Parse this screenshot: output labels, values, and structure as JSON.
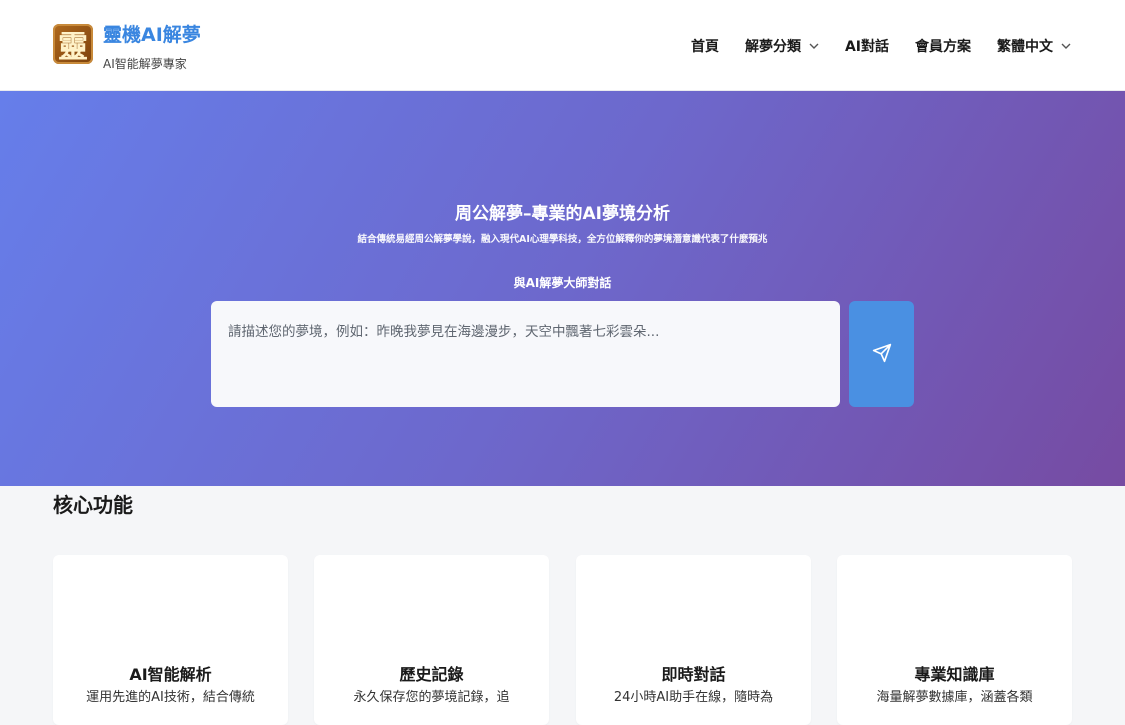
{
  "header": {
    "logo_glyph": "靈",
    "brand_name": "靈機AI解夢",
    "brand_tagline": "AI智能解夢專家",
    "nav": [
      {
        "label": "首頁",
        "dropdown": false
      },
      {
        "label": "解夢分類",
        "dropdown": true
      },
      {
        "label": "AI對話",
        "dropdown": false
      },
      {
        "label": "會員方案",
        "dropdown": false
      },
      {
        "label": "繁體中文",
        "dropdown": true
      }
    ]
  },
  "hero": {
    "title": "周公解夢–專業的AI夢境分析",
    "subtitle": "結合傳統易經周公解夢學說，融入現代AI心理學科技，全方位解釋你的夢境潛意識代表了什麼預兆",
    "chat_label": "與AI解夢大師對話",
    "input_placeholder": "請描述您的夢境，例如：昨晚我夢見在海邊漫步，天空中飄著七彩雲朵...",
    "send_icon": "paper-plane-icon"
  },
  "features": {
    "title": "核心功能",
    "cards": [
      {
        "title": "AI智能解析",
        "desc": "運用先進的AI技術，結合傳統"
      },
      {
        "title": "歷史記錄",
        "desc": "永久保存您的夢境記錄，追"
      },
      {
        "title": "即時對話",
        "desc": "24小時AI助手在線，隨時為"
      },
      {
        "title": "專業知識庫",
        "desc": "海量解夢數據庫，涵蓋各類"
      }
    ]
  },
  "colors": {
    "brand": "#3a86e0",
    "hero_gradient_start": "#667eea",
    "hero_gradient_end": "#764ba2",
    "send_button": "#4a90e2"
  }
}
